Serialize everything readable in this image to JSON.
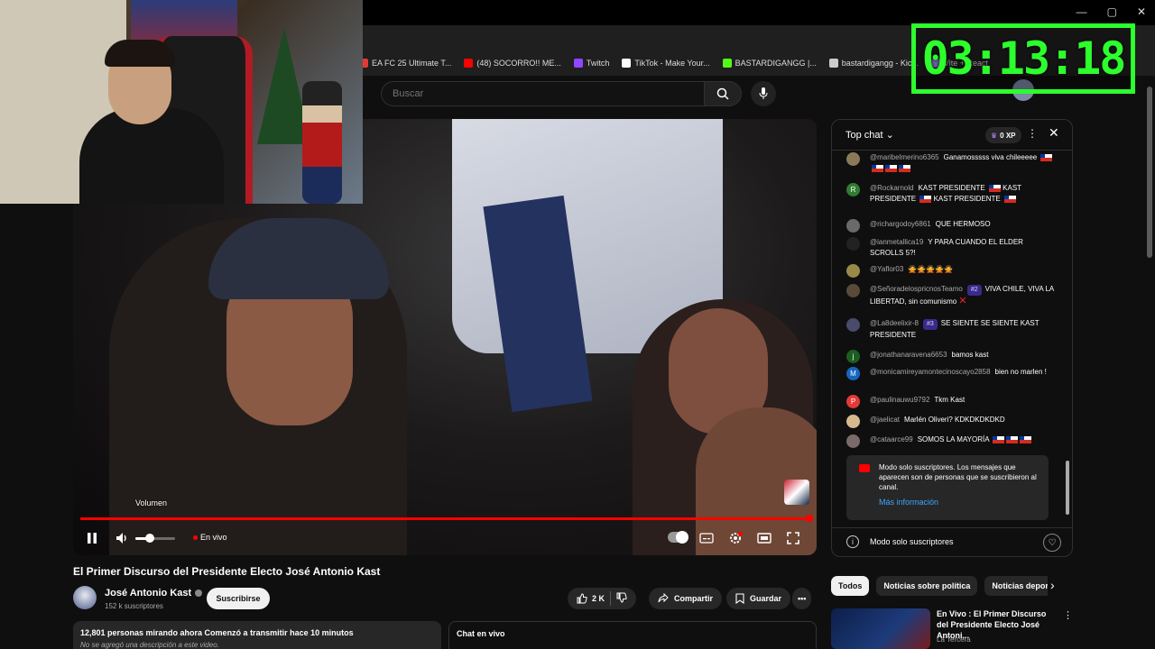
{
  "bookmarks": [
    {
      "label": "EA FC 25 Ultimate T...",
      "color": "#e53935"
    },
    {
      "label": "(48) SOCORRO!! ME...",
      "color": "#ff0000"
    },
    {
      "label": "Twitch",
      "color": "#9146ff"
    },
    {
      "label": "TikTok - Make Your...",
      "color": "#ffffff"
    },
    {
      "label": "BASTARDIGANGG |...",
      "color": "#53fc18"
    },
    {
      "label": "bastardigangg - Kic...",
      "color": "#cccccc"
    },
    {
      "label": "Vite + React",
      "color": "#a78bfa"
    }
  ],
  "timer": "03:13:18",
  "search": {
    "placeholder": "Buscar"
  },
  "player": {
    "volume_tooltip": "Volumen",
    "live_label": "En vivo",
    "progress_colors": {
      "bar": "#ff0000"
    }
  },
  "video": {
    "title": "El Primer Discurso del Presidente Electo José Antonio Kast",
    "channel": "José Antonio Kast",
    "subscribers": "152 k suscriptores",
    "subscribe_label": "Suscribirse",
    "likes": "2 K",
    "share_label": "Compartir",
    "save_label": "Guardar",
    "more_label": "•••"
  },
  "description": {
    "stats": "12,801 personas mirando ahora  Comenzó a transmitir hace 10 minutos",
    "text": "No se agregó una descripción a este video."
  },
  "livechat_label": "Chat en vivo",
  "chat": {
    "header": "Top chat",
    "xp": "0 XP",
    "messages": [
      {
        "author": "@maribelmerino6365",
        "text": "Ganamosssss viva chileeeee",
        "flags": 4,
        "avatar": "#8a7a5a"
      },
      {
        "author": "@Rockarnold",
        "text": "KAST PRESIDENTE",
        "text2": "KAST PRESIDENTE",
        "text3": "KAST PRESIDENTE",
        "avatar": "#2e7d32",
        "initial": "R"
      },
      {
        "author": "@richargodoy6861",
        "text": "QUE HERMOSO",
        "avatar": "#6a6a6a"
      },
      {
        "author": "@ianmetallica19",
        "text": "Y PARA CUANDO EL ELDER SCROLLS 5?!",
        "avatar": "#222222"
      },
      {
        "author": "@Yaflor03",
        "text": "🙅🙅🙅🙅🙅",
        "avatar": "#9a8a4a"
      },
      {
        "author": "@SeñoradelospricnosTeamo",
        "badge": "#2",
        "text": "VIVA CHILE, VIVA LA LIBERTAD, sin comunismo",
        "avatar": "#5a4a3a"
      },
      {
        "author": "@La8deelixir-8",
        "badge": "#3",
        "text": "SE SIENTE SE SIENTE KAST PRESIDENTE",
        "avatar": "#4a4a6a"
      },
      {
        "author": "@jonathanaravena6653",
        "text": "bamos kast",
        "avatar": "#1b5e20",
        "initial": "j"
      },
      {
        "author": "@monicamireyamontecinoscayo2858",
        "text": "bien no marlen !",
        "avatar": "#1565c0",
        "initial": "M"
      },
      {
        "author": "@paulinauwu9792",
        "text": "Tkm Kast",
        "avatar": "#e53935",
        "initial": "P"
      },
      {
        "author": "@jaelicat",
        "text": "Marlén Oliveri? KDKDKDKDKD",
        "avatar": "#d7b98e"
      },
      {
        "author": "@cataarce99",
        "text": "SOMOS LA MAYORÍA",
        "flags": 3,
        "avatar": "#7a6a6a"
      }
    ],
    "notice": "Modo solo suscriptores. Los mensajes que aparecen son de personas que se suscribieron al canal.",
    "notice_link": "Más información",
    "footer": "Modo solo suscriptores"
  },
  "chips": [
    "Todos",
    "Noticias sobre política",
    "Noticias deportivas"
  ],
  "related": {
    "title": "En Vivo : El Primer Discurso del Presidente Electo José Antoni...",
    "channel": "La Tercera"
  }
}
